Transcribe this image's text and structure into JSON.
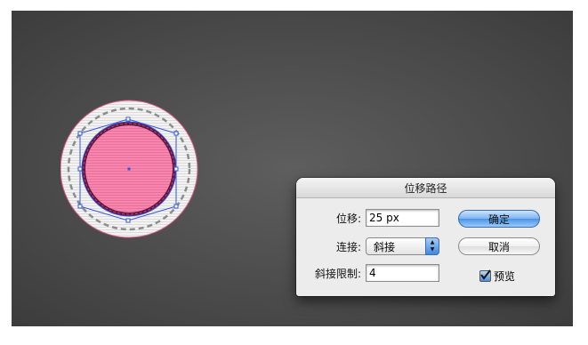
{
  "dialog": {
    "title": "位移路径",
    "offset_label": "位移:",
    "offset_value": "25 px",
    "joins_label": "连接:",
    "joins_selected": "斜接",
    "miter_label": "斜接限制:",
    "miter_value": "4",
    "ok_label": "确定",
    "cancel_label": "取消",
    "preview_label": "预览",
    "preview_checked": true
  },
  "colors": {
    "badge_fill": "#f47fa9",
    "badge_ring": "#6b1f4a",
    "selection": "#3355dd"
  }
}
